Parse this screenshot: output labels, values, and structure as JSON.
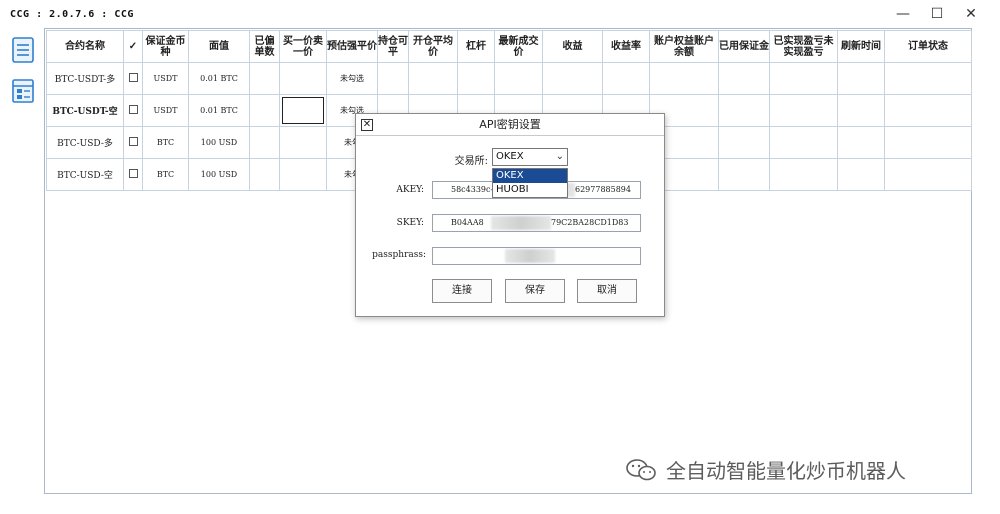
{
  "window": {
    "title": "CCG : 2.0.7.6 : CCG",
    "minimize_glyph": "—",
    "maximize_glyph": "☐",
    "close_glyph": "✕"
  },
  "sidebar": {
    "icons": [
      "document-list-icon",
      "window-list-icon"
    ]
  },
  "grid": {
    "headers": [
      "合约名称",
      "✓",
      "保证金币种",
      "面值",
      "已偏单数",
      "买一价卖一价",
      "预估强平价",
      "持仓可平",
      "开仓平均价",
      "杠杆",
      "最新成交价",
      "收益",
      "收益率",
      "账户权益账户余额",
      "已用保证金",
      "已实现盈亏未实现盈亏",
      "刷新时间",
      "订单状态"
    ],
    "rows": [
      {
        "name": "BTC-USDT-多",
        "margin": "USDT",
        "face": "0.01 BTC",
        "status": "未勾选"
      },
      {
        "name": "BTC-USDT-空",
        "margin": "USDT",
        "face": "0.01 BTC",
        "status": "未勾选"
      },
      {
        "name": "BTC-USD-多",
        "margin": "BTC",
        "face": "100 USD",
        "status": "未勾"
      },
      {
        "name": "BTC-USD-空",
        "margin": "BTC",
        "face": "100 USD",
        "status": "未勾"
      }
    ]
  },
  "dialog": {
    "title": "API密钥设置",
    "close_glyph": "✕",
    "exchange_label": "交易所:",
    "exchange_value": "OKEX",
    "exchange_options": [
      "OKEX",
      "HUOBI"
    ],
    "akey_label": "AKEY:",
    "akey_prefix": "58c4339c-",
    "akey_suffix": "62977885894",
    "skey_label": "SKEY:",
    "skey_prefix": "B04AA8",
    "skey_suffix": "79C2BA28CD1D83",
    "passphrase_label": "passphrass:",
    "buttons": {
      "connect": "连接",
      "save": "保存",
      "cancel": "取消"
    }
  },
  "watermark": {
    "text": "全自动智能量化炒币机器人"
  }
}
